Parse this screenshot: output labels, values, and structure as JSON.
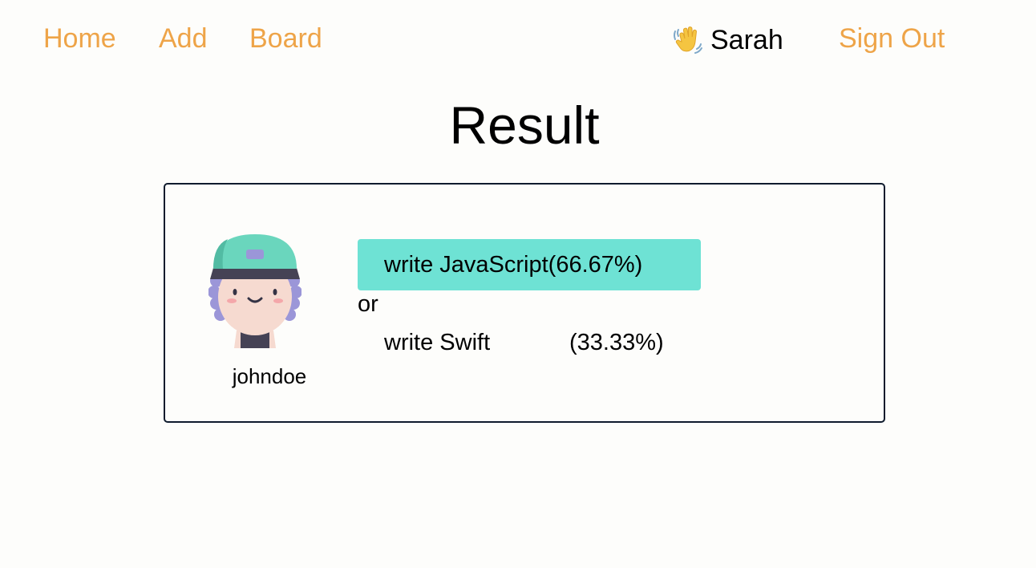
{
  "nav": {
    "home": "Home",
    "add": "Add",
    "board": "Board",
    "sign_out": "Sign Out"
  },
  "user": {
    "greeting_icon": "waving-hand-icon",
    "name": "Sarah"
  },
  "page": {
    "title": "Result"
  },
  "result": {
    "author": {
      "username": "johndoe",
      "avatar_icon": "avatar-boy-cap-icon"
    },
    "options": [
      {
        "text": "write JavaScript",
        "percent": "(66.67%)",
        "winner": true
      },
      {
        "text": "write Swift",
        "percent": "(33.33%)",
        "winner": false
      }
    ],
    "separator": "or"
  },
  "colors": {
    "accent": "#eea448",
    "winner_highlight": "#6ee2d4",
    "card_border": "#0f1b2d",
    "background": "#fdfdfb"
  }
}
